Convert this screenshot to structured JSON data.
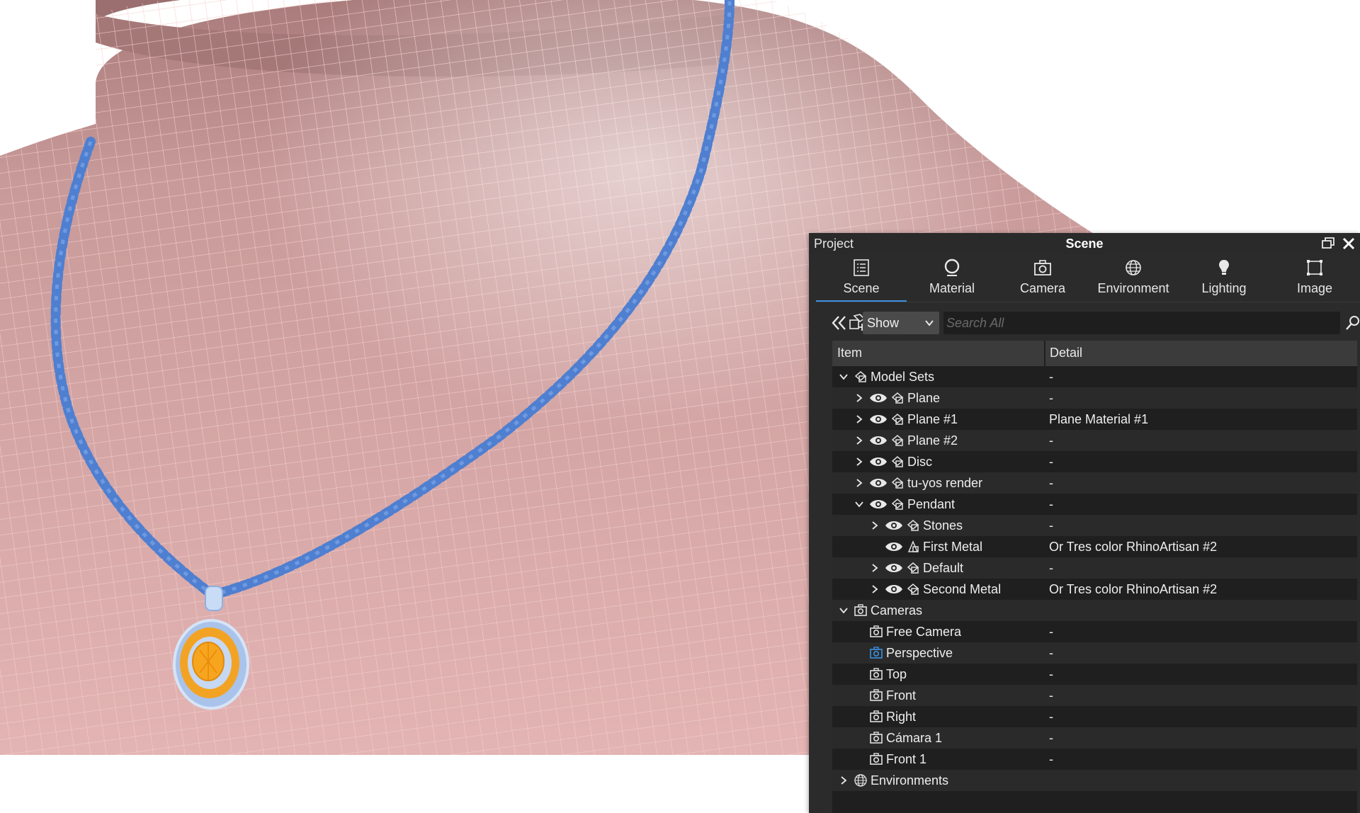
{
  "panel": {
    "project_label": "Project",
    "title": "Scene",
    "restore_icon": "restore-window-icon",
    "close_icon": "close-icon"
  },
  "tabs": [
    {
      "label": "Scene",
      "icon": "list-icon",
      "active": true
    },
    {
      "label": "Material",
      "icon": "material-ball-icon",
      "active": false
    },
    {
      "label": "Camera",
      "icon": "camera-icon",
      "active": false
    },
    {
      "label": "Environment",
      "icon": "globe-icon",
      "active": false
    },
    {
      "label": "Lighting",
      "icon": "bulb-icon",
      "active": false
    },
    {
      "label": "Image",
      "icon": "frame-icon",
      "active": false
    }
  ],
  "toolbar": {
    "collapse_icon": "double-chevron-left-icon",
    "add_model_set_icon": "add-model-set-icon",
    "show_value": "Show",
    "search_placeholder": "Search All",
    "search_icon": "search-icon"
  },
  "table": {
    "headers": {
      "item": "Item",
      "detail": "Detail"
    },
    "rows": [
      {
        "label": "Model Sets",
        "detail": "-",
        "icon": "model-set-icon",
        "chevron": "down",
        "eye": false,
        "level": 0
      },
      {
        "label": "Plane",
        "detail": "-",
        "icon": "model-set-icon",
        "chevron": "right",
        "eye": true,
        "level": 1
      },
      {
        "label": "Plane #1",
        "detail": "Plane Material #1",
        "icon": "model-set-icon",
        "chevron": "right",
        "eye": true,
        "level": 1
      },
      {
        "label": "Plane #2",
        "detail": "-",
        "icon": "model-set-icon",
        "chevron": "right",
        "eye": true,
        "level": 1
      },
      {
        "label": "Disc",
        "detail": "-",
        "icon": "model-set-icon",
        "chevron": "right",
        "eye": true,
        "level": 1
      },
      {
        "label": "tu-yos render",
        "detail": "-",
        "icon": "model-set-icon",
        "chevron": "right",
        "eye": true,
        "level": 1
      },
      {
        "label": "Pendant",
        "detail": "-",
        "icon": "model-set-icon",
        "chevron": "down",
        "eye": true,
        "level": 1
      },
      {
        "label": "Stones",
        "detail": "-",
        "icon": "model-set-icon",
        "chevron": "right",
        "eye": true,
        "level": 2
      },
      {
        "label": "First Metal",
        "detail": "Or Tres color RhinoArtisan  #2",
        "icon": "model-part-icon",
        "chevron": "none",
        "eye": true,
        "level": 2
      },
      {
        "label": "Default",
        "detail": "-",
        "icon": "model-set-icon",
        "chevron": "right",
        "eye": true,
        "level": 2
      },
      {
        "label": "Second Metal",
        "detail": "Or Tres color RhinoArtisan  #2",
        "icon": "model-set-icon",
        "chevron": "right",
        "eye": true,
        "level": 2
      },
      {
        "label": "Cameras",
        "detail": "",
        "icon": "camera-icon",
        "chevron": "down",
        "eye": false,
        "level": 0
      },
      {
        "label": "Free Camera",
        "detail": "-",
        "icon": "camera-icon",
        "chevron": "none",
        "eye": false,
        "level": 1
      },
      {
        "label": "Perspective",
        "detail": "-",
        "icon": "camera-icon",
        "chevron": "none",
        "eye": false,
        "level": 1,
        "highlight": true
      },
      {
        "label": "Top",
        "detail": "-",
        "icon": "camera-icon",
        "chevron": "none",
        "eye": false,
        "level": 1
      },
      {
        "label": "Front",
        "detail": "-",
        "icon": "camera-icon",
        "chevron": "none",
        "eye": false,
        "level": 1
      },
      {
        "label": "Right",
        "detail": "-",
        "icon": "camera-icon",
        "chevron": "none",
        "eye": false,
        "level": 1
      },
      {
        "label": "Cámara 1",
        "detail": "-",
        "icon": "camera-icon",
        "chevron": "none",
        "eye": false,
        "level": 1
      },
      {
        "label": "Front 1",
        "detail": "-",
        "icon": "camera-icon",
        "chevron": "none",
        "eye": false,
        "level": 1
      },
      {
        "label": "Environments",
        "detail": "",
        "icon": "globe-icon",
        "chevron": "right",
        "eye": false,
        "level": 0
      }
    ]
  },
  "colors": {
    "mannequin": "#d9a7a6",
    "mannequin_wire": "#f2c9c6",
    "chain": "#4f7fd0",
    "pendant_frame": "#b8d0f0",
    "stone": "#f5a020",
    "panel_bg": "#2b2b2b",
    "tab_accent": "#3d8fe0",
    "perspective_icon": "#3d8fe0"
  }
}
